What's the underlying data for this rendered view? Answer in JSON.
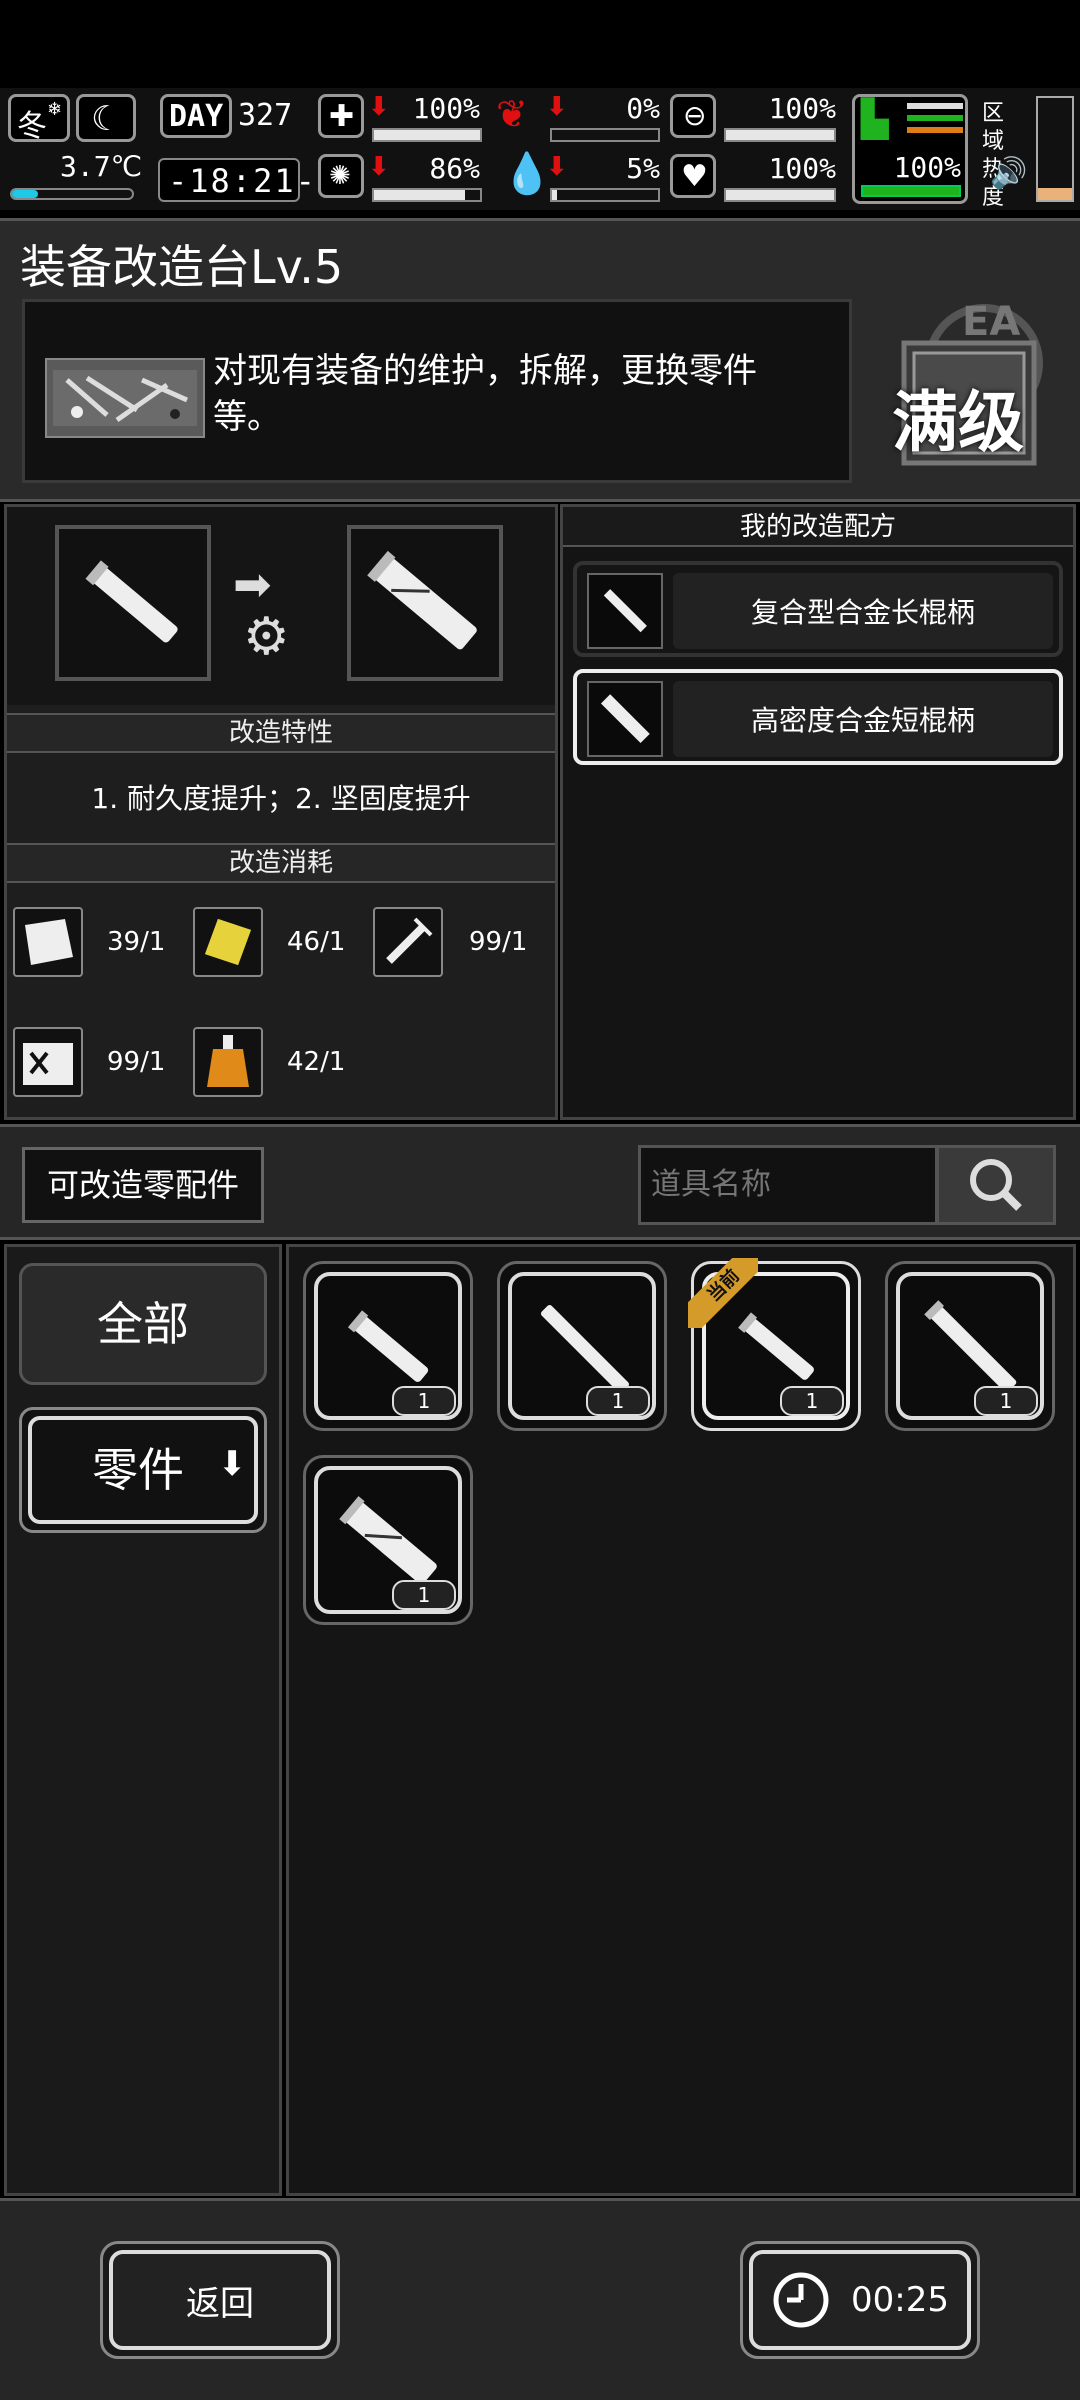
{
  "hud": {
    "season": "冬",
    "temperature": "3.7℃",
    "day_label": "DAY",
    "day_number": "327",
    "clock": "-18:21-",
    "stats": {
      "health": "100%",
      "stomach": "0%",
      "mask": "100%",
      "stamina": "100%",
      "brain": "86%",
      "blood": "5%",
      "heart": "100%"
    },
    "zone_heat_label": "区域热度"
  },
  "workbench": {
    "title": "装备改造台Lv.5",
    "description": "对现有装备的维护，拆解，更换零件等。",
    "level_badge": "满级",
    "badge_letters": "EA"
  },
  "modify": {
    "traits_header": "改造特性",
    "traits_text": "1. 耐久度提升；2. 坚固度提升",
    "cost_header": "改造消耗",
    "costs": [
      {
        "icon": "cloth-icon",
        "value": "39/1"
      },
      {
        "icon": "gold-plate-icon",
        "value": "46/1"
      },
      {
        "icon": "syringe-icon",
        "value": "99/1"
      },
      {
        "icon": "battery-box-icon",
        "value": "99/1"
      },
      {
        "icon": "flask-icon",
        "value": "42/1"
      }
    ]
  },
  "recipes": {
    "header": "我的改造配方",
    "items": [
      {
        "label": "复合型合金长棍柄"
      },
      {
        "label": "高密度合金短棍柄"
      }
    ]
  },
  "parts": {
    "modifiable_label": "可改造零配件",
    "search_placeholder": "道具名称",
    "tab_all": "全部",
    "tab_parts": "零件",
    "current_tag": "当前",
    "items": [
      {
        "qty": "1"
      },
      {
        "qty": "1"
      },
      {
        "qty": "1"
      },
      {
        "qty": "1"
      },
      {
        "qty": "1"
      }
    ]
  },
  "footer": {
    "back_label": "返回",
    "timer": "00:25"
  },
  "colors": {
    "accent_orange": "#d49a2a",
    "stat_red": "#e01010",
    "stamina_green": "#1fb31f",
    "temp_blue": "#1ec8e6"
  }
}
